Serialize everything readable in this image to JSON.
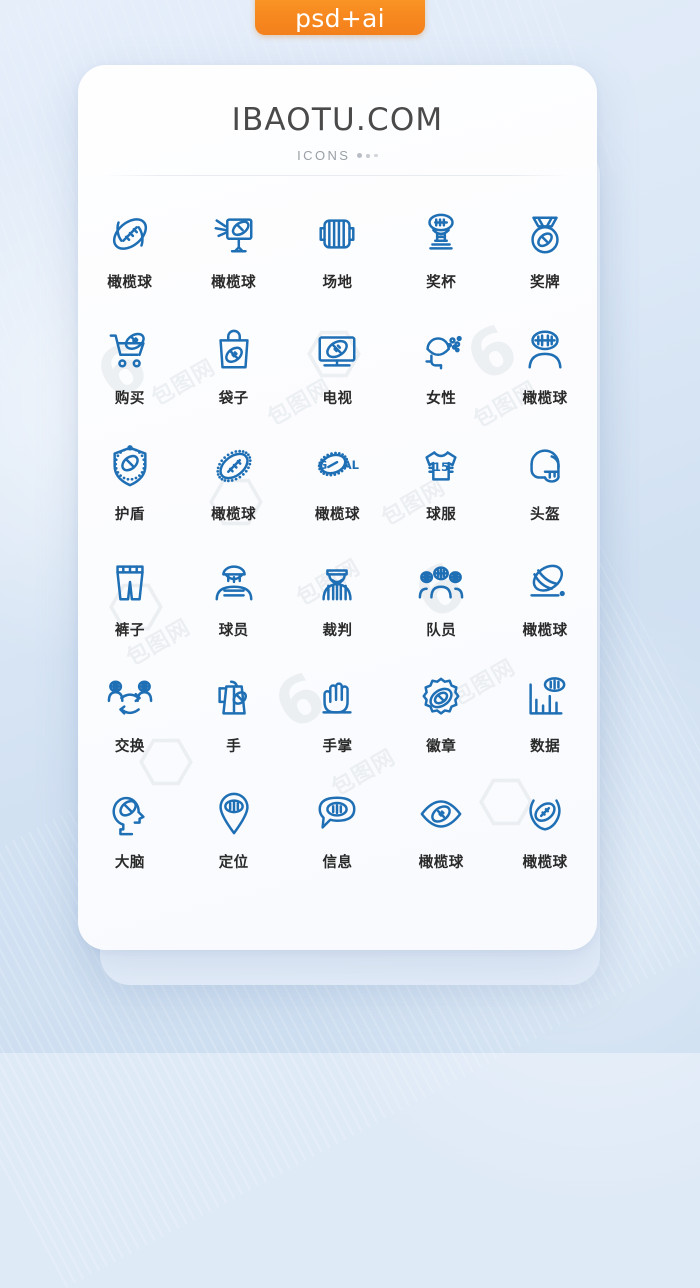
{
  "badge": {
    "label": "psd+ai",
    "color": "#f7891f"
  },
  "card": {
    "brand": "IBAOTU.COM",
    "subtitle": "ICONS",
    "icon_color": "#1f6fb5",
    "label_color": "#2a2a2a",
    "background": "#fcfdff"
  },
  "watermark": {
    "text": "包图网"
  },
  "icons": [
    {
      "label": "橄榄球",
      "icon": "football-icon"
    },
    {
      "label": "橄榄球",
      "icon": "football-throw-board-icon"
    },
    {
      "label": "场地",
      "icon": "field-icon"
    },
    {
      "label": "奖杯",
      "icon": "trophy-icon"
    },
    {
      "label": "奖牌",
      "icon": "medal-icon"
    },
    {
      "label": "购买",
      "icon": "shopping-cart-football-icon"
    },
    {
      "label": "袋子",
      "icon": "shopping-bag-football-icon"
    },
    {
      "label": "电视",
      "icon": "television-football-icon"
    },
    {
      "label": "女性",
      "icon": "female-fan-icon"
    },
    {
      "label": "橄榄球",
      "icon": "player-head-football-icon"
    },
    {
      "label": "护盾",
      "icon": "shield-football-icon"
    },
    {
      "label": "橄榄球",
      "icon": "football-dotted-icon"
    },
    {
      "label": "橄榄球",
      "icon": "goal-football-icon"
    },
    {
      "label": "球服",
      "icon": "jersey-15-icon"
    },
    {
      "label": "头盔",
      "icon": "helmet-icon"
    },
    {
      "label": "裤子",
      "icon": "pants-icon"
    },
    {
      "label": "球员",
      "icon": "player-icon"
    },
    {
      "label": "裁判",
      "icon": "referee-icon"
    },
    {
      "label": "队员",
      "icon": "team-members-icon"
    },
    {
      "label": "橄榄球",
      "icon": "hand-catch-football-icon"
    },
    {
      "label": "交换",
      "icon": "exchange-players-icon"
    },
    {
      "label": "手",
      "icon": "hand-holding-football-icon"
    },
    {
      "label": "手掌",
      "icon": "palm-icon"
    },
    {
      "label": "徽章",
      "icon": "badge-football-icon"
    },
    {
      "label": "数据",
      "icon": "data-chart-football-icon"
    },
    {
      "label": "大脑",
      "icon": "brain-head-football-icon"
    },
    {
      "label": "定位",
      "icon": "location-pin-football-icon"
    },
    {
      "label": "信息",
      "icon": "message-bubble-football-icon"
    },
    {
      "label": "橄榄球",
      "icon": "eye-football-icon"
    },
    {
      "label": "橄榄球",
      "icon": "laurel-football-icon"
    }
  ],
  "jersey_number": "15",
  "goal_text": "GOAL"
}
